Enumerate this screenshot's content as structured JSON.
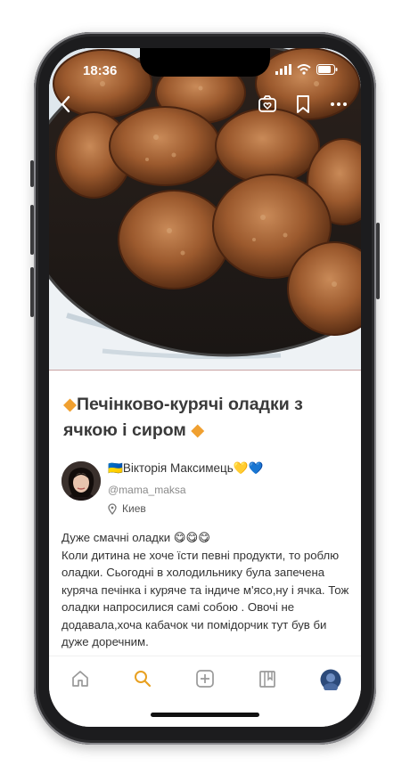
{
  "status_bar": {
    "time": "18:36"
  },
  "recipe": {
    "title_diamond": "◆",
    "title": "Печінково-курячі оладки з ячкою і сиром",
    "author": {
      "flag": "🇺🇦",
      "name": "Вікторія Максимець",
      "hearts": "💛💙",
      "handle": "@mama_maksa",
      "location": "Киев"
    },
    "description_lead": "Дуже смачні оладки 😋😋😋",
    "description_body": "Коли дитина не хоче їсти певні продукти, то роблю оладки. Сьогодні в холодильнику була запечена куряча печінка і куряче та індиче м'ясо,ну і ячка. Тож оладки напросилися самі собою . Овочі не додавала,хоча кабачок чи помідорчик тут був би дуже доречним."
  },
  "icons": {
    "back": "chevron-left-icon",
    "cooksnap": "camera-heart-icon",
    "bookmark": "bookmark-icon",
    "more": "more-horizontal-icon",
    "location": "location-pin-icon",
    "tab_home": "home-icon",
    "tab_search": "search-icon",
    "tab_add": "add-square-icon",
    "tab_library": "library-icon",
    "tab_profile": "avatar-icon"
  },
  "colors": {
    "accent": "#f0a030",
    "search_active": "#e8a020",
    "text": "#3a3a3a"
  }
}
